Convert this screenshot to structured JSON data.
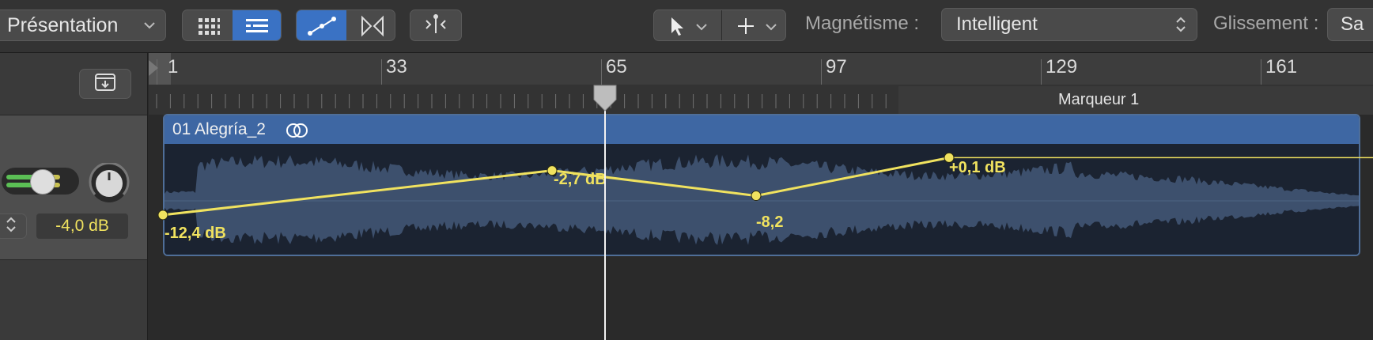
{
  "toolbar": {
    "view_menu_label": "Présentation",
    "snap_label": "Magnétisme :",
    "snap_value": "Intelligent",
    "drag_label": "Glissement :",
    "drag_value": "Sa"
  },
  "ruler": {
    "bars": [
      "1",
      "33",
      "65",
      "97",
      "129",
      "161"
    ],
    "marker_label": "Marqueur 1"
  },
  "track": {
    "volume_readout": "-4,0 dB"
  },
  "region": {
    "name": "01 Alegría_2",
    "automation_labels": [
      "-12,4 dB",
      "-2,7 dB",
      "-8,2",
      "+0,1 dB"
    ]
  },
  "automation": {
    "values_db": [
      -12.4,
      -2.7,
      -8.2,
      0.1
    ]
  },
  "colors": {
    "accent": "#3a72c4",
    "region_header": "#3e67a3",
    "automation": "#f0e25f"
  }
}
